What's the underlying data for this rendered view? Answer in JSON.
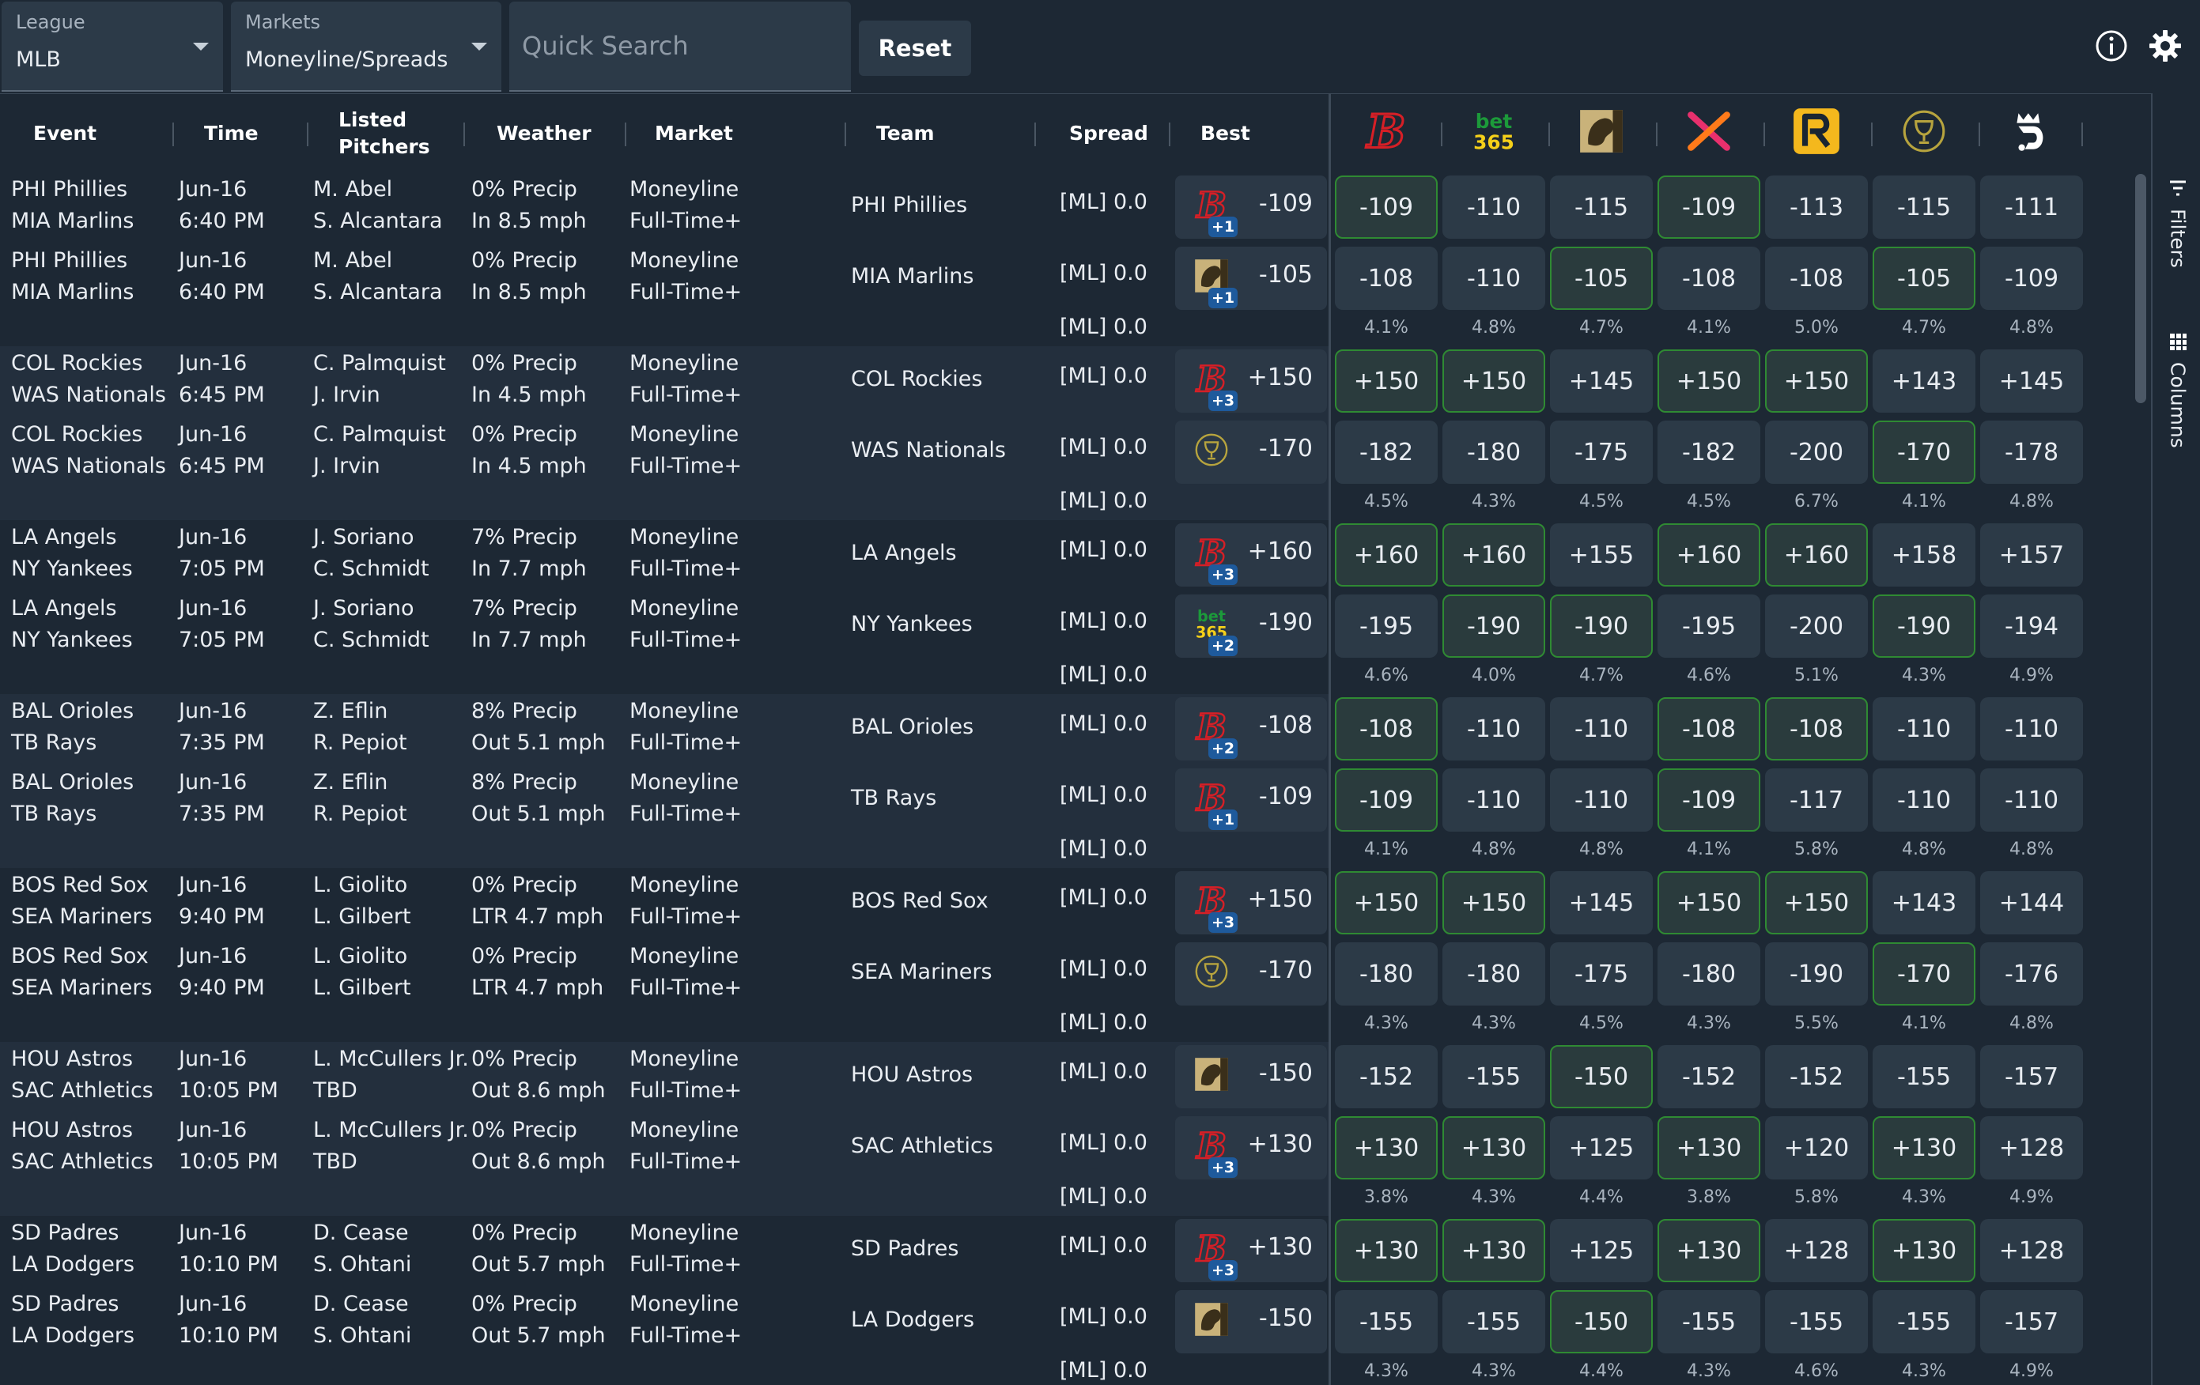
{
  "filters": {
    "league": {
      "label": "League",
      "value": "MLB"
    },
    "markets": {
      "label": "Markets",
      "value": "Moneyline/Spreads"
    },
    "search": {
      "placeholder": "Quick Search"
    },
    "reset_label": "Reset"
  },
  "columns": {
    "event": "Event",
    "time": "Time",
    "pitchers": "Listed Pitchers",
    "weather": "Weather",
    "market": "Market",
    "team": "Team",
    "spread": "Spread",
    "best": "Best"
  },
  "books": [
    "bally-b",
    "bet365",
    "caesars-lion",
    "x-sportsbook",
    "r-sportsbook",
    "goblet",
    "draftkings"
  ],
  "side_tabs": {
    "filters": "Filters",
    "columns": "Columns"
  },
  "games": [
    {
      "rows": [
        {
          "event": [
            "PHI Phillies",
            "MIA Marlins"
          ],
          "time": [
            "Jun-16",
            "6:40 PM"
          ],
          "pitchers": [
            "M. Abel",
            "S. Alcantara"
          ],
          "weather": [
            "0% Precip",
            "In 8.5 mph"
          ],
          "market": [
            "Moneyline",
            "Full-Time+"
          ],
          "team": "PHI Phillies",
          "spread": "[ML] 0.0",
          "best": {
            "book": "bally-b",
            "badge": "+1",
            "value": "-109"
          },
          "odds": [
            "-109",
            "-110",
            "-115",
            "-109",
            "-113",
            "-115",
            "-111"
          ],
          "hl": [
            true,
            false,
            false,
            true,
            false,
            false,
            false
          ]
        },
        {
          "event": [
            "PHI Phillies",
            "MIA Marlins"
          ],
          "time": [
            "Jun-16",
            "6:40 PM"
          ],
          "pitchers": [
            "M. Abel",
            "S. Alcantara"
          ],
          "weather": [
            "0% Precip",
            "In 8.5 mph"
          ],
          "market": [
            "Moneyline",
            "Full-Time+"
          ],
          "team": "MIA Marlins",
          "spread": "[ML] 0.0",
          "best": {
            "book": "caesars-lion",
            "badge": "+1",
            "value": "-105"
          },
          "odds": [
            "-108",
            "-110",
            "-105",
            "-108",
            "-108",
            "-105",
            "-109"
          ],
          "hl": [
            false,
            false,
            true,
            false,
            false,
            true,
            false
          ]
        }
      ],
      "spread3": "[ML] 0.0",
      "pct": [
        "4.1%",
        "4.8%",
        "4.7%",
        "4.1%",
        "5.0%",
        "4.7%",
        "4.8%"
      ]
    },
    {
      "rows": [
        {
          "event": [
            "COL Rockies",
            "WAS Nationals"
          ],
          "time": [
            "Jun-16",
            "6:45 PM"
          ],
          "pitchers": [
            "C. Palmquist",
            "J. Irvin"
          ],
          "weather": [
            "0% Precip",
            "In 4.5 mph"
          ],
          "market": [
            "Moneyline",
            "Full-Time+"
          ],
          "team": "COL Rockies",
          "spread": "[ML] 0.0",
          "best": {
            "book": "bally-b",
            "badge": "+3",
            "value": "+150"
          },
          "odds": [
            "+150",
            "+150",
            "+145",
            "+150",
            "+150",
            "+143",
            "+145"
          ],
          "hl": [
            true,
            true,
            false,
            true,
            true,
            false,
            false
          ]
        },
        {
          "event": [
            "COL Rockies",
            "WAS Nationals"
          ],
          "time": [
            "Jun-16",
            "6:45 PM"
          ],
          "pitchers": [
            "C. Palmquist",
            "J. Irvin"
          ],
          "weather": [
            "0% Precip",
            "In 4.5 mph"
          ],
          "market": [
            "Moneyline",
            "Full-Time+"
          ],
          "team": "WAS Nationals",
          "spread": "[ML] 0.0",
          "best": {
            "book": "goblet",
            "badge": "",
            "value": "-170"
          },
          "odds": [
            "-182",
            "-180",
            "-175",
            "-182",
            "-200",
            "-170",
            "-178"
          ],
          "hl": [
            false,
            false,
            false,
            false,
            false,
            true,
            false
          ]
        }
      ],
      "spread3": "[ML] 0.0",
      "pct": [
        "4.5%",
        "4.3%",
        "4.5%",
        "4.5%",
        "6.7%",
        "4.1%",
        "4.8%"
      ]
    },
    {
      "rows": [
        {
          "event": [
            "LA Angels",
            "NY Yankees"
          ],
          "time": [
            "Jun-16",
            "7:05 PM"
          ],
          "pitchers": [
            "J. Soriano",
            "C. Schmidt"
          ],
          "weather": [
            "7% Precip",
            "In 7.7 mph"
          ],
          "market": [
            "Moneyline",
            "Full-Time+"
          ],
          "team": "LA Angels",
          "spread": "[ML] 0.0",
          "best": {
            "book": "bally-b",
            "badge": "+3",
            "value": "+160"
          },
          "odds": [
            "+160",
            "+160",
            "+155",
            "+160",
            "+160",
            "+158",
            "+157"
          ],
          "hl": [
            true,
            true,
            false,
            true,
            true,
            false,
            false
          ]
        },
        {
          "event": [
            "LA Angels",
            "NY Yankees"
          ],
          "time": [
            "Jun-16",
            "7:05 PM"
          ],
          "pitchers": [
            "J. Soriano",
            "C. Schmidt"
          ],
          "weather": [
            "7% Precip",
            "In 7.7 mph"
          ],
          "market": [
            "Moneyline",
            "Full-Time+"
          ],
          "team": "NY Yankees",
          "spread": "[ML] 0.0",
          "best": {
            "book": "bet365",
            "badge": "+2",
            "value": "-190"
          },
          "odds": [
            "-195",
            "-190",
            "-190",
            "-195",
            "-200",
            "-190",
            "-194"
          ],
          "hl": [
            false,
            true,
            true,
            false,
            false,
            true,
            false
          ]
        }
      ],
      "spread3": "[ML] 0.0",
      "pct": [
        "4.6%",
        "4.0%",
        "4.7%",
        "4.6%",
        "5.1%",
        "4.3%",
        "4.9%"
      ]
    },
    {
      "rows": [
        {
          "event": [
            "BAL Orioles",
            "TB Rays"
          ],
          "time": [
            "Jun-16",
            "7:35 PM"
          ],
          "pitchers": [
            "Z. Eflin",
            "R. Pepiot"
          ],
          "weather": [
            "8% Precip",
            "Out 5.1 mph"
          ],
          "market": [
            "Moneyline",
            "Full-Time+"
          ],
          "team": "BAL Orioles",
          "spread": "[ML] 0.0",
          "best": {
            "book": "bally-b",
            "badge": "+2",
            "value": "-108"
          },
          "odds": [
            "-108",
            "-110",
            "-110",
            "-108",
            "-108",
            "-110",
            "-110"
          ],
          "hl": [
            true,
            false,
            false,
            true,
            true,
            false,
            false
          ]
        },
        {
          "event": [
            "BAL Orioles",
            "TB Rays"
          ],
          "time": [
            "Jun-16",
            "7:35 PM"
          ],
          "pitchers": [
            "Z. Eflin",
            "R. Pepiot"
          ],
          "weather": [
            "8% Precip",
            "Out 5.1 mph"
          ],
          "market": [
            "Moneyline",
            "Full-Time+"
          ],
          "team": "TB Rays",
          "spread": "[ML] 0.0",
          "best": {
            "book": "bally-b",
            "badge": "+1",
            "value": "-109"
          },
          "odds": [
            "-109",
            "-110",
            "-110",
            "-109",
            "-117",
            "-110",
            "-110"
          ],
          "hl": [
            true,
            false,
            false,
            true,
            false,
            false,
            false
          ]
        }
      ],
      "spread3": "[ML] 0.0",
      "pct": [
        "4.1%",
        "4.8%",
        "4.8%",
        "4.1%",
        "5.8%",
        "4.8%",
        "4.8%"
      ]
    },
    {
      "rows": [
        {
          "event": [
            "BOS Red Sox",
            "SEA Mariners"
          ],
          "time": [
            "Jun-16",
            "9:40 PM"
          ],
          "pitchers": [
            "L. Giolito",
            "L. Gilbert"
          ],
          "weather": [
            "0% Precip",
            "LTR 4.7 mph"
          ],
          "market": [
            "Moneyline",
            "Full-Time+"
          ],
          "team": "BOS Red Sox",
          "spread": "[ML] 0.0",
          "best": {
            "book": "bally-b",
            "badge": "+3",
            "value": "+150"
          },
          "odds": [
            "+150",
            "+150",
            "+145",
            "+150",
            "+150",
            "+143",
            "+144"
          ],
          "hl": [
            true,
            true,
            false,
            true,
            true,
            false,
            false
          ]
        },
        {
          "event": [
            "BOS Red Sox",
            "SEA Mariners"
          ],
          "time": [
            "Jun-16",
            "9:40 PM"
          ],
          "pitchers": [
            "L. Giolito",
            "L. Gilbert"
          ],
          "weather": [
            "0% Precip",
            "LTR 4.7 mph"
          ],
          "market": [
            "Moneyline",
            "Full-Time+"
          ],
          "team": "SEA Mariners",
          "spread": "[ML] 0.0",
          "best": {
            "book": "goblet",
            "badge": "",
            "value": "-170"
          },
          "odds": [
            "-180",
            "-180",
            "-175",
            "-180",
            "-190",
            "-170",
            "-176"
          ],
          "hl": [
            false,
            false,
            false,
            false,
            false,
            true,
            false
          ]
        }
      ],
      "spread3": "[ML] 0.0",
      "pct": [
        "4.3%",
        "4.3%",
        "4.5%",
        "4.3%",
        "5.5%",
        "4.1%",
        "4.8%"
      ]
    },
    {
      "rows": [
        {
          "event": [
            "HOU Astros",
            "SAC Athletics"
          ],
          "time": [
            "Jun-16",
            "10:05 PM"
          ],
          "pitchers": [
            "L. McCullers Jr.",
            "TBD"
          ],
          "weather": [
            "0% Precip",
            "Out 8.6 mph"
          ],
          "market": [
            "Moneyline",
            "Full-Time+"
          ],
          "team": "HOU Astros",
          "spread": "[ML] 0.0",
          "best": {
            "book": "caesars-lion",
            "badge": "",
            "value": "-150"
          },
          "odds": [
            "-152",
            "-155",
            "-150",
            "-152",
            "-152",
            "-155",
            "-157"
          ],
          "hl": [
            false,
            false,
            true,
            false,
            false,
            false,
            false
          ]
        },
        {
          "event": [
            "HOU Astros",
            "SAC Athletics"
          ],
          "time": [
            "Jun-16",
            "10:05 PM"
          ],
          "pitchers": [
            "L. McCullers Jr.",
            "TBD"
          ],
          "weather": [
            "0% Precip",
            "Out 8.6 mph"
          ],
          "market": [
            "Moneyline",
            "Full-Time+"
          ],
          "team": "SAC Athletics",
          "spread": "[ML] 0.0",
          "best": {
            "book": "bally-b",
            "badge": "+3",
            "value": "+130"
          },
          "odds": [
            "+130",
            "+130",
            "+125",
            "+130",
            "+120",
            "+130",
            "+128"
          ],
          "hl": [
            true,
            true,
            false,
            true,
            false,
            true,
            false
          ]
        }
      ],
      "spread3": "[ML] 0.0",
      "pct": [
        "3.8%",
        "4.3%",
        "4.4%",
        "3.8%",
        "5.8%",
        "4.3%",
        "4.9%"
      ]
    },
    {
      "rows": [
        {
          "event": [
            "SD Padres",
            "LA Dodgers"
          ],
          "time": [
            "Jun-16",
            "10:10 PM"
          ],
          "pitchers": [
            "D. Cease",
            "S. Ohtani"
          ],
          "weather": [
            "0% Precip",
            "Out 5.7 mph"
          ],
          "market": [
            "Moneyline",
            "Full-Time+"
          ],
          "team": "SD Padres",
          "spread": "[ML] 0.0",
          "best": {
            "book": "bally-b",
            "badge": "+3",
            "value": "+130"
          },
          "odds": [
            "+130",
            "+130",
            "+125",
            "+130",
            "+128",
            "+130",
            "+128"
          ],
          "hl": [
            true,
            true,
            false,
            true,
            false,
            true,
            false
          ]
        },
        {
          "event": [
            "SD Padres",
            "LA Dodgers"
          ],
          "time": [
            "Jun-16",
            "10:10 PM"
          ],
          "pitchers": [
            "D. Cease",
            "S. Ohtani"
          ],
          "weather": [
            "0% Precip",
            "Out 5.7 mph"
          ],
          "market": [
            "Moneyline",
            "Full-Time+"
          ],
          "team": "LA Dodgers",
          "spread": "[ML] 0.0",
          "best": {
            "book": "caesars-lion",
            "badge": "",
            "value": "-150"
          },
          "odds": [
            "-155",
            "-155",
            "-150",
            "-155",
            "-155",
            "-155",
            "-157"
          ],
          "hl": [
            false,
            false,
            true,
            false,
            false,
            false,
            false
          ]
        }
      ],
      "spread3": "[ML] 0.0",
      "pct": [
        "4.3%",
        "4.3%",
        "4.4%",
        "4.3%",
        "4.6%",
        "4.3%",
        "4.9%"
      ]
    }
  ]
}
